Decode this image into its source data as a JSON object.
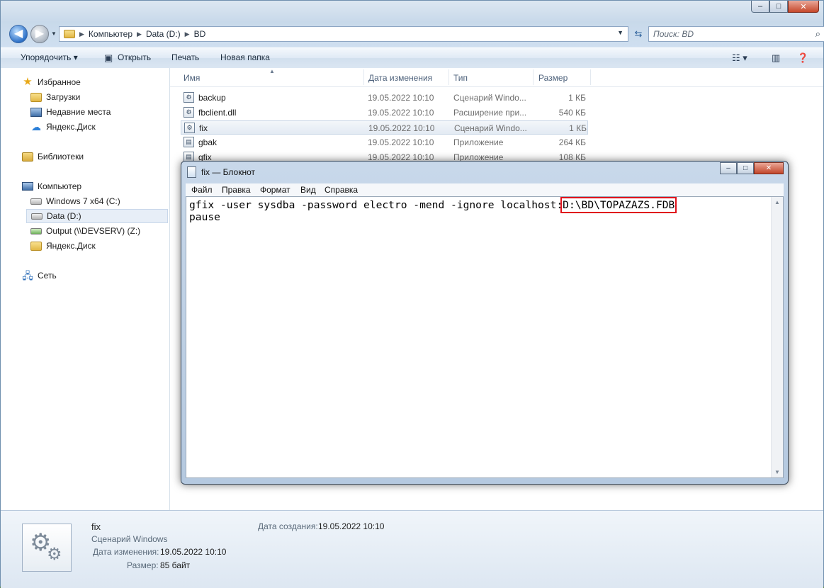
{
  "window": {
    "title_buttons": [
      "minimize",
      "maximize",
      "close"
    ]
  },
  "address": {
    "crumbs": [
      "Компьютер",
      "Data (D:)",
      "BD"
    ],
    "search_placeholder": "Поиск: BD"
  },
  "toolbar": {
    "organize": "Упорядочить",
    "open": "Открыть",
    "print": "Печать",
    "new_folder": "Новая папка"
  },
  "sidebar": {
    "favorites": "Избранное",
    "fav_items": [
      "Загрузки",
      "Недавние места",
      "Яндекс.Диск"
    ],
    "libraries": "Библиотеки",
    "computer": "Компьютер",
    "computer_items": [
      "Windows 7 x64 (C:)",
      "Data (D:)",
      "Output (\\\\DEVSERV) (Z:)",
      "Яндекс.Диск"
    ],
    "network": "Сеть"
  },
  "columns": {
    "name": "Имя",
    "date": "Дата изменения",
    "type": "Тип",
    "size": "Размер"
  },
  "files": [
    {
      "name": "backup",
      "date": "19.05.2022 10:10",
      "type": "Сценарий Windo...",
      "size": "1 КБ"
    },
    {
      "name": "fbclient.dll",
      "date": "19.05.2022 10:10",
      "type": "Расширение при...",
      "size": "540 КБ"
    },
    {
      "name": "fix",
      "date": "19.05.2022 10:10",
      "type": "Сценарий Windo...",
      "size": "1 КБ",
      "selected": true
    },
    {
      "name": "gbak",
      "date": "19.05.2022 10:10",
      "type": "Приложение",
      "size": "264 КБ"
    },
    {
      "name": "gfix",
      "date": "19.05.2022 10:10",
      "type": "Приложение",
      "size": "108 КБ"
    }
  ],
  "details": {
    "name": "fix",
    "type": "Сценарий Windows",
    "modified_label": "Дата изменения:",
    "modified_value": "19.05.2022 10:10",
    "size_label": "Размер:",
    "size_value": "85 байт",
    "created_label": "Дата создания:",
    "created_value": "19.05.2022 10:10"
  },
  "notepad": {
    "title": "fix — Блокнот",
    "menu": [
      "Файл",
      "Правка",
      "Формат",
      "Вид",
      "Справка"
    ],
    "line1_prefix": "gfix -user sysdba -password electro -mend -ignore localhost:",
    "line1_highlight": "D:\\BD\\TOPAZAZS.FDB",
    "line2": "pause",
    "highlight_color": "#e0121b"
  }
}
